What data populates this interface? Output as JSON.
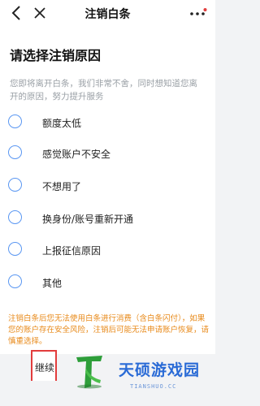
{
  "nav": {
    "title": "注销白条",
    "back_icon": "chevron-left-icon",
    "close_icon": "close-icon",
    "more_icon": "more-dots-icon"
  },
  "heading": "请选择注销原因",
  "intro": "您即将离开白条，我们非常不舍，同时想知道您离开的原因，努力提升服务",
  "options": [
    {
      "label": "额度太低",
      "selected": false
    },
    {
      "label": "感觉账户不安全",
      "selected": false
    },
    {
      "label": "不想用了",
      "selected": false
    },
    {
      "label": "换身份/账号重新开通",
      "selected": false
    },
    {
      "label": "上报征信原因",
      "selected": false
    },
    {
      "label": "其他",
      "selected": false
    }
  ],
  "warning": "注销白条后您无法使用白条进行消费（含白条闪付），如果您的账户存在安全风险，注销后可能无法申请账户恢复，请慎重选择。",
  "continue_label": "继续",
  "watermark": {
    "name": "天硕游戏园",
    "sub": "TIANSHUO.CC"
  },
  "colors": {
    "radio_border": "#5a97f2",
    "warning_text": "#e88a1a",
    "highlight_box": "#e23c3c",
    "watermark": "#2a6bd6"
  }
}
